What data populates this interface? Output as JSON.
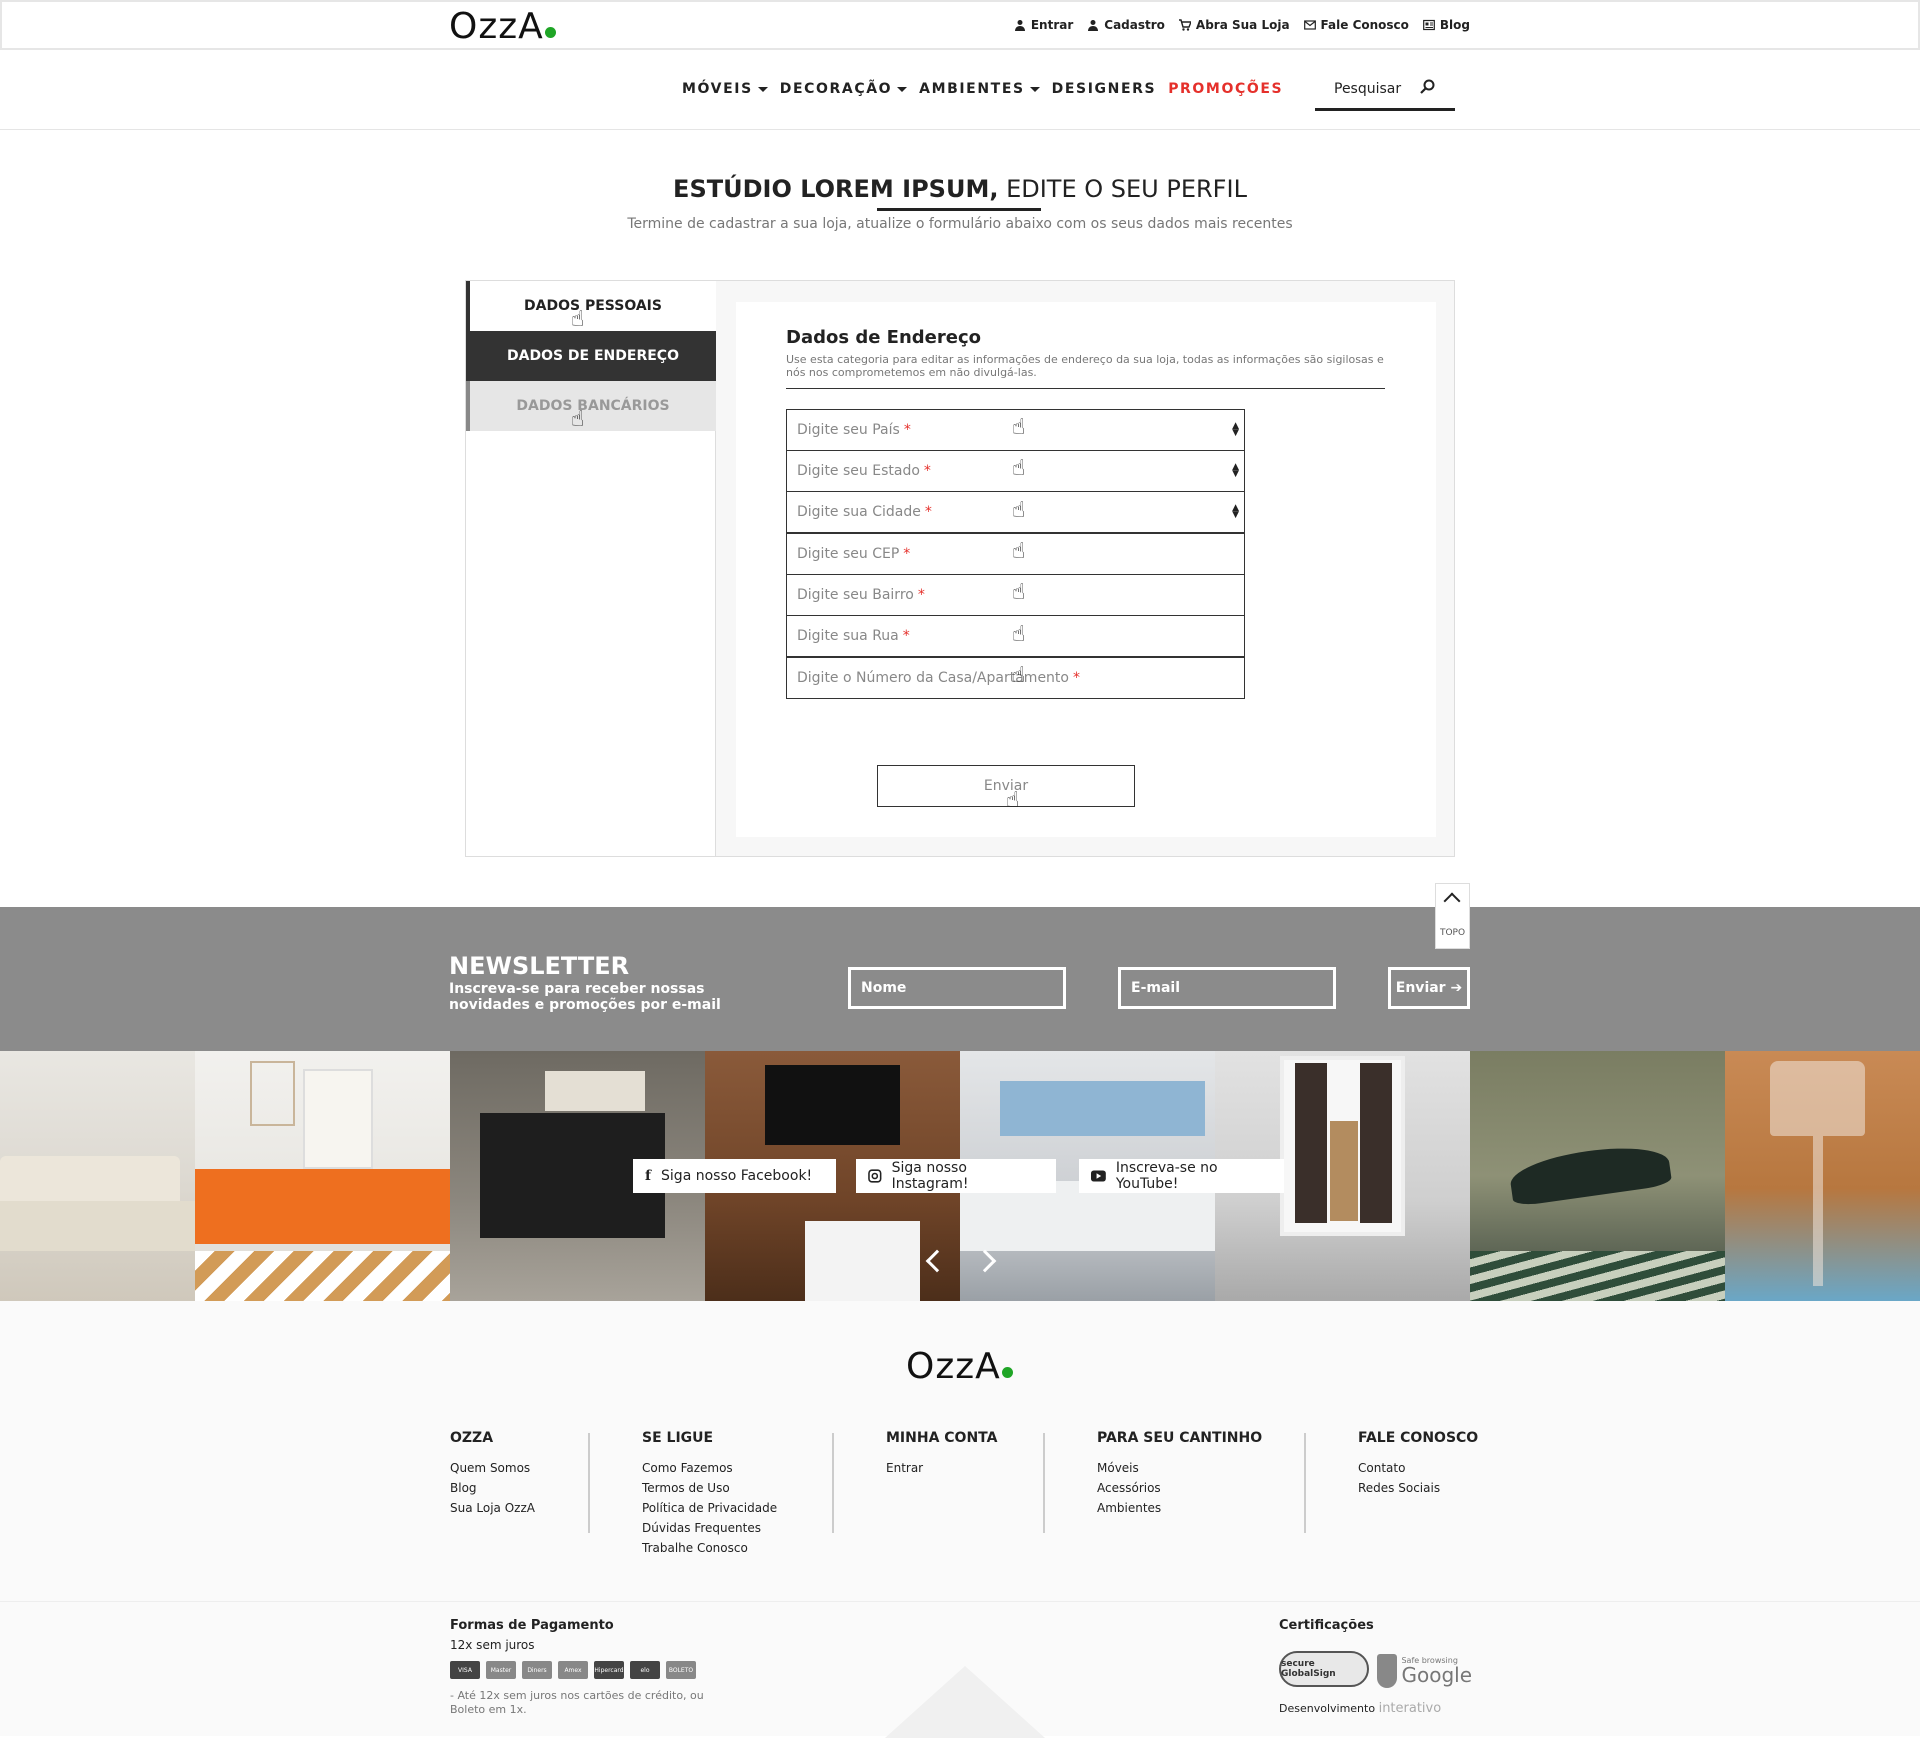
{
  "brand": {
    "logo_text": "OzzA",
    "accent": "#1fa526",
    "promo_color": "#e5302b"
  },
  "top_links": [
    {
      "label": "Entrar",
      "icon": "user-icon"
    },
    {
      "label": "Cadastro",
      "icon": "add-user-icon"
    },
    {
      "label": "Abra Sua Loja",
      "icon": "cart-icon"
    },
    {
      "label": "Fale Conosco",
      "icon": "mail-icon"
    },
    {
      "label": "Blog",
      "icon": "blog-icon"
    }
  ],
  "nav": {
    "items": [
      "MÓVEIS",
      "DECORAÇÃO",
      "AMBIENTES",
      "DESIGNERS",
      "PROMOÇÕES"
    ],
    "search_label": "Pesquisar"
  },
  "page": {
    "title_bold": "ESTÚDIO LOREM IPSUM,",
    "title_rest": " EDITE O SEU PERFIL",
    "subtitle": "Termine de cadastrar a sua loja, atualize o formulário abaixo com os seus dados mais recentes"
  },
  "tabs": [
    "DADOS PESSOAIS",
    "DADOS DE ENDEREÇO",
    "DADOS BANCÁRIOS"
  ],
  "form": {
    "heading": "Dados de Endereço",
    "description": "Use esta categoria para editar as informações de endereço da sua loja, todas as informações são sigilosas e nós nos comprometemos em não divulgá-las.",
    "fields": [
      {
        "placeholder": "Digite seu País",
        "required": "*"
      },
      {
        "placeholder": "Digite seu Estado",
        "required": "*"
      },
      {
        "placeholder": "Digite sua Cidade",
        "required": "*"
      },
      {
        "placeholder": "Digite seu CEP",
        "required": "*"
      },
      {
        "placeholder": "Digite seu Bairro",
        "required": "*"
      },
      {
        "placeholder": "Digite sua Rua",
        "required": "*"
      },
      {
        "placeholder": "Digite o Número da Casa/Apartamento",
        "required": "*"
      }
    ],
    "submit": "Enviar"
  },
  "topo": "TOPO",
  "newsletter": {
    "title": "NEWSLETTER",
    "subtitle": "Inscreva-se para receber nossas novidades e promoções por e-mail",
    "name_placeholder": "Nome",
    "email_placeholder": "E-mail",
    "button": "Enviar ➔"
  },
  "social": {
    "facebook": "Siga nosso Facebook!",
    "instagram": "Siga nosso Instagram!",
    "youtube": "Inscreva-se no YouTube!"
  },
  "footer": {
    "columns": [
      {
        "title": "OZZA",
        "links": [
          "Quem Somos",
          "Blog",
          "Sua Loja OzzA"
        ]
      },
      {
        "title": "SE LIGUE",
        "links": [
          "Como Fazemos",
          "Termos de Uso",
          "Política de Privacidade",
          "Dúvidas Frequentes",
          "Trabalhe Conosco"
        ]
      },
      {
        "title": "MINHA CONTA",
        "links": [
          "Entrar"
        ]
      },
      {
        "title": "PARA SEU CANTINHO",
        "links": [
          "Móveis",
          "Acessórios",
          "Ambientes"
        ]
      },
      {
        "title": "FALE CONOSCO",
        "links": [
          "Contato",
          "Redes Sociais"
        ]
      }
    ],
    "payment_title": "Formas de Pagamento",
    "payment_sub": "12x sem juros",
    "cards": [
      "VISA",
      "Master",
      "Diners",
      "Amex",
      "Hipercard",
      "elo",
      "BOLETO"
    ],
    "payment_note": "- Até 12x sem juros nos cartões de crédito, ou Boleto em 1x.",
    "cert_title": "Certificações",
    "cert_secure": "secure GlobalSign",
    "cert_google_small": "Safe browsing",
    "cert_google": "Google",
    "dev_label": "Desenvolvimento",
    "dev_brand": "interativo"
  }
}
